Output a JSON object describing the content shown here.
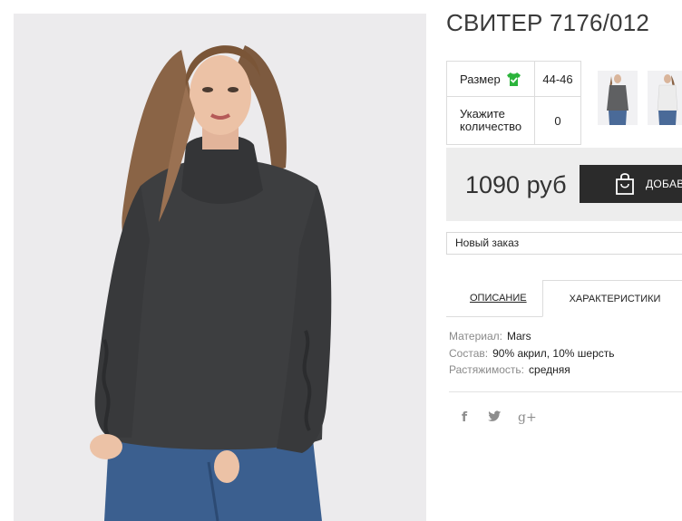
{
  "product": {
    "title": "СВИТЕР 7176/012"
  },
  "options": {
    "size_label": "Размер",
    "size_value": "44-46",
    "qty_label_line1": "Укажите",
    "qty_label_line2": "количество",
    "qty_value": "0"
  },
  "purchase": {
    "price": "1090 руб",
    "add_label": "ДОБАВ"
  },
  "order": {
    "selected": "Новый заказ"
  },
  "tabs": [
    {
      "label": "ОПИСАНИЕ",
      "active": false
    },
    {
      "label": "ХАРАКТЕРИСТИКИ",
      "active": true
    }
  ],
  "specs": [
    {
      "key": "Материал:",
      "value": "Mars"
    },
    {
      "key": "Состав:",
      "value": "90% акрил, 10% шерсть"
    },
    {
      "key": "Растяжимость:",
      "value": "средняя"
    }
  ],
  "social": {
    "facebook": "f",
    "googleplus": "g+"
  },
  "icons": {
    "size_chart": "tshirt-check-icon",
    "add_to_cart": "shopping-bag-icon",
    "facebook": "facebook-icon",
    "twitter": "twitter-icon",
    "googleplus": "google-plus-icon"
  },
  "colors": {
    "accent_green": "#2bb43b",
    "button_dark": "#2b2b2b",
    "price_bg": "#ededed",
    "sweater": "#3d3e40"
  }
}
